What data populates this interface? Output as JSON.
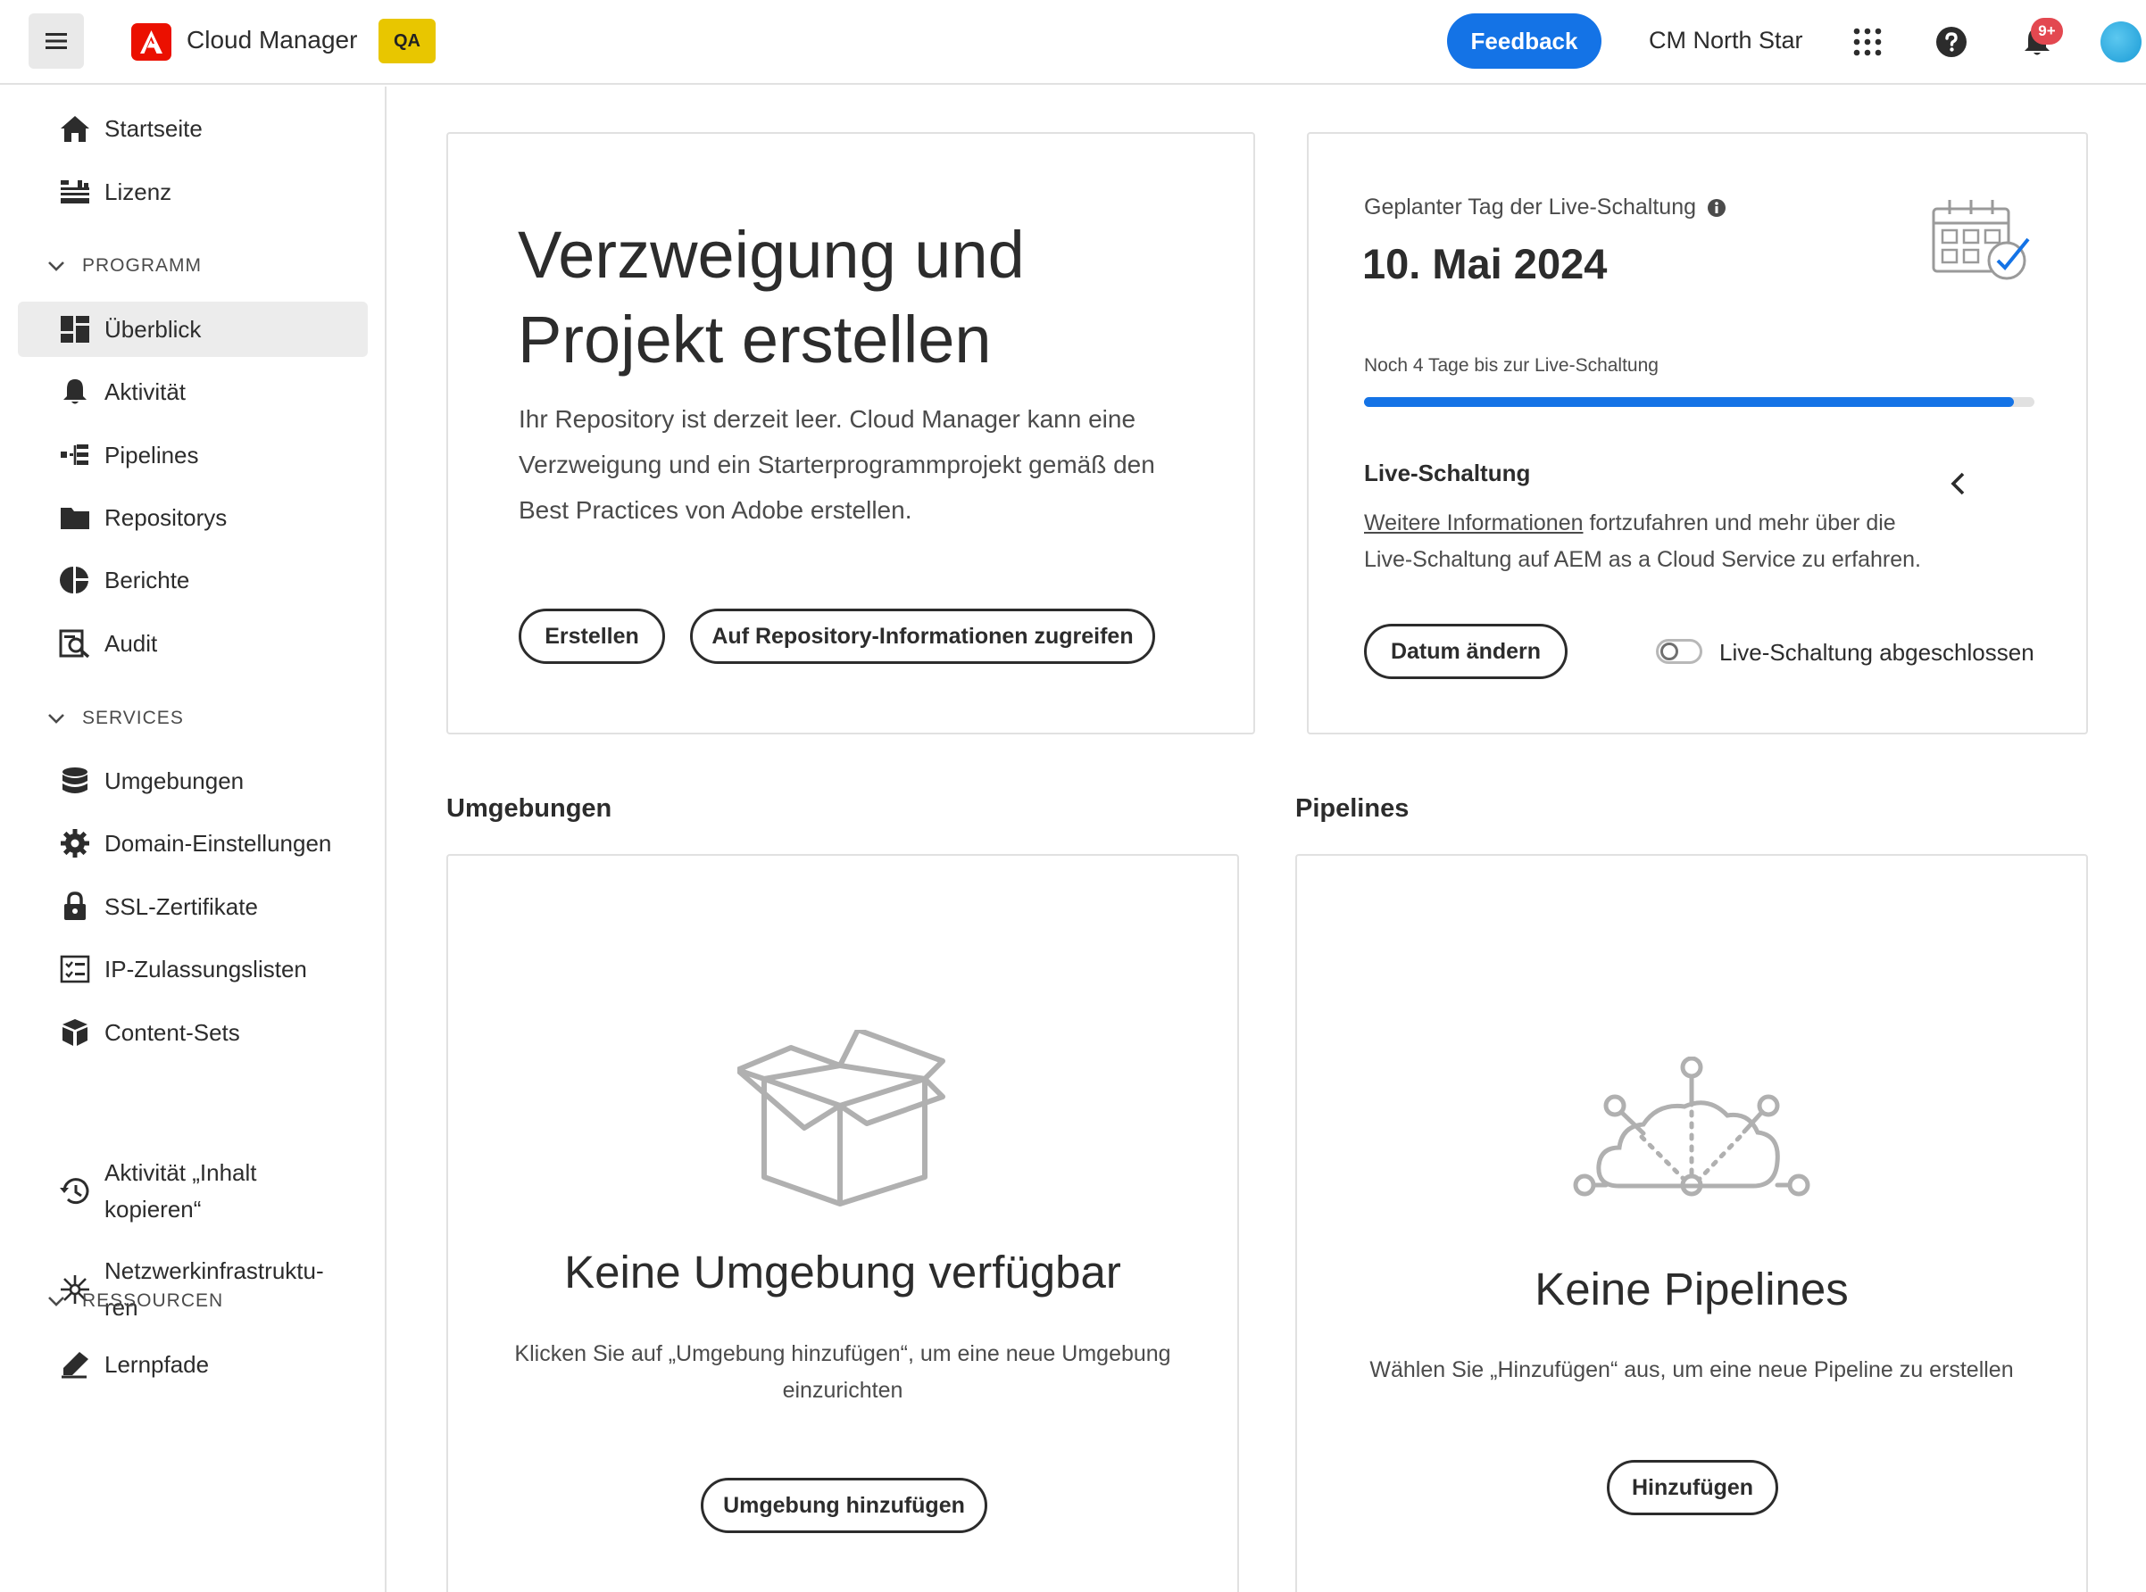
{
  "header": {
    "app_name": "Cloud Manager",
    "env_badge": "QA",
    "feedback_label": "Feedback",
    "org_name": "CM North Star",
    "notification_count": "9+",
    "colors": {
      "feedback": "#1473e6",
      "badge": "#e8c600",
      "logo": "#eb1000",
      "notification": "#e34850"
    }
  },
  "sidebar": {
    "top_items": [
      {
        "label": "Startseite",
        "icon": "home-icon"
      },
      {
        "label": "Lizenz",
        "icon": "license-icon"
      }
    ],
    "program_section": "PROGRAMM",
    "program_items": [
      {
        "label": "Überblick",
        "icon": "overview-icon",
        "active": true
      },
      {
        "label": "Aktivität",
        "icon": "bell-icon"
      },
      {
        "label": "Pipelines",
        "icon": "pipelines-icon"
      },
      {
        "label": "Repositorys",
        "icon": "folder-icon"
      },
      {
        "label": "Berichte",
        "icon": "reports-icon"
      },
      {
        "label": "Audit",
        "icon": "audit-icon"
      }
    ],
    "services_section": "SERVICES",
    "services_items": [
      {
        "label": "Umgebungen",
        "icon": "database-icon"
      },
      {
        "label": "Domain-Einstellungen",
        "icon": "gear-icon"
      },
      {
        "label": "SSL-Zertifikate",
        "icon": "lock-icon"
      },
      {
        "label": "IP-Zulassungslisten",
        "icon": "checklist-icon"
      },
      {
        "label": "Content-Sets",
        "icon": "boxes-icon"
      },
      {
        "label": "Aktivität „Inhalt",
        "label2": "kopieren“",
        "icon": "history-icon"
      },
      {
        "label": "Netzwerkinfrastruktu-",
        "label2": "ren",
        "icon": "network-icon"
      }
    ],
    "resources_section": "RESSOURCEN",
    "resources_items": [
      {
        "label": "Lernpfade",
        "icon": "learn-icon"
      }
    ]
  },
  "create_card": {
    "title_line1": "Verzweigung und",
    "title_line2": "Projekt erstellen",
    "desc_line1": "Ihr Repository ist derzeit leer. Cloud Manager kann eine",
    "desc_line2": "Verzweigung und ein Starterprogrammprojekt gemäß den",
    "desc_line3": "Best Practices von Adobe erstellen.",
    "create_btn": "Erstellen",
    "repo_btn": "Auf Repository-Informationen zugreifen"
  },
  "golive_card": {
    "label": "Geplanter Tag der Live-Schaltung",
    "date": "10. Mai 2024",
    "countdown": "Noch 4 Tage bis zur Live-Schaltung",
    "progress_percent": 97,
    "section_title": "Live-Schaltung",
    "info_link": "Weitere Informationen",
    "info_text1": " fortzufahren und mehr über die",
    "info_text2": "Live-Schaltung auf AEM as a Cloud Service zu erfahren.",
    "change_btn": "Datum ändern",
    "toggle_label": "Live-Schaltung abgeschlossen",
    "toggle_on": false
  },
  "environments": {
    "section_title": "Umgebungen",
    "empty_title": "Keine Umgebung verfügbar",
    "empty_desc1": "Klicken Sie auf „Umgebung hinzufügen“, um eine neue Umgebung",
    "empty_desc2": "einzurichten",
    "add_btn": "Umgebung hinzufügen"
  },
  "pipelines": {
    "section_title": "Pipelines",
    "empty_title": "Keine Pipelines",
    "empty_desc": "Wählen Sie „Hinzufügen“ aus, um eine neue Pipeline zu erstellen",
    "add_btn": "Hinzufügen"
  }
}
